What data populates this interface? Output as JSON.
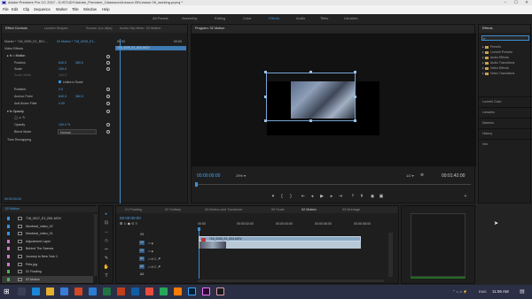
{
  "window": {
    "title": "Adobe Premiere Pro CC 2017 - D:\\STUDY\\Adobe_Premiere_Classroom\\Lesson 09\\Lesson 09_working.prproj *",
    "controls": [
      "–",
      "☐",
      "✕"
    ]
  },
  "menu": [
    "File",
    "Edit",
    "Clip",
    "Sequence",
    "Marker",
    "Title",
    "Window",
    "Help"
  ],
  "workspaces": [
    "All Panels",
    "Assembly",
    "Editing",
    "Color",
    "Effects",
    "Audio",
    "Titles",
    "Libraries"
  ],
  "workspace_active": "Effects",
  "effect_controls": {
    "tabs": [
      "Effect Controls",
      "Lumetri Scopes",
      "Source: (no clips)",
      "Audio Clip Mixer: 02 Motion"
    ],
    "header_left": "Master * 718_0005_E1_B01 ...",
    "header_right": "02 Motion * 718_0005_E1...",
    "timecode_start": "00:00",
    "timecode_end": "00:00",
    "clip_label": "718_0005_E1_B01.MOV",
    "section": "Video Effects",
    "motion": {
      "label": "Motion",
      "position_label": "Position",
      "position_x": "640.0",
      "position_y": "360.0",
      "scale_label": "Scale",
      "scale": "100.0",
      "scale_width_label": "Scale Width",
      "scale_width": "100.0",
      "uniform_label": "Uniform Scale",
      "rotation_label": "Rotation",
      "rotation": "0.0",
      "anchor_label": "Anchor Point",
      "anchor_x": "640.0",
      "anchor_y": "360.0",
      "flicker_label": "Anti-flicker Filter",
      "flicker": "0.00"
    },
    "opacity": {
      "label": "Opacity",
      "opacity_label": "Opacity",
      "opacity": "100.0 %",
      "blend_label": "Blend Mode",
      "blend": "Normal"
    },
    "time_remap": "Time Remapping",
    "bottom_tc": "00:00:00:00"
  },
  "program": {
    "title": "Program: 02 Motion",
    "timecode": "00:00:00:00",
    "zoom": "29%",
    "quality": "1/2",
    "duration": "00:01:42:00",
    "playhead_fraction": 0.0
  },
  "effects_panel": {
    "title": "Effects",
    "search_placeholder": "",
    "folders": [
      "Presets",
      "Lumetri Presets",
      "Audio Effects",
      "Audio Transitions",
      "Video Effects",
      "Video Transitions"
    ],
    "sections": [
      "Lumetri Color",
      "Libraries",
      "Markers",
      "History",
      "Info"
    ]
  },
  "project": {
    "header": "02 Motion",
    "items": [
      {
        "name": "718_0017_E1_B01.MOV",
        "color": "#3c8fd6"
      },
      {
        "name": "Montreal_video_02",
        "color": "#3c8fd6"
      },
      {
        "name": "Montreal_video_01",
        "color": "#3c8fd6"
      },
      {
        "name": "Adjustment Layer",
        "color": "#c77ac7"
      },
      {
        "name": "Behind The Scenes",
        "color": "#c77ac7"
      },
      {
        "name": "Journey to New York 1",
        "color": "#c77ac7"
      },
      {
        "name": "Pets.jpg",
        "color": "#c77ac7"
      },
      {
        "name": "01 Floating",
        "color": "#4caf50"
      },
      {
        "name": "02 Motion",
        "color": "#4caf50"
      }
    ]
  },
  "timeline": {
    "tabs": [
      "01 Floating",
      "02 Solitary",
      "04 Motion and Transform",
      "05 Scale",
      "02 Motion",
      "03 Montage"
    ],
    "active_tab": "02 Motion",
    "timecode": "00:00:00:00",
    "ruler": [
      "00:00",
      "00:00:02:00",
      "00:00:04:00",
      "00:00:06:00",
      "00:00:08:00"
    ],
    "tracks": [
      "V3",
      "V2",
      "V1",
      "A1",
      "A2",
      "A3"
    ],
    "clip_label": "718_0005_E1_B01.MOV"
  },
  "tools": [
    "▸",
    "⊡",
    "↔",
    "◇",
    "⇿",
    "✎",
    "✋",
    "T"
  ],
  "taskbar": {
    "time": "11:06 AM",
    "lang": "ENG"
  }
}
